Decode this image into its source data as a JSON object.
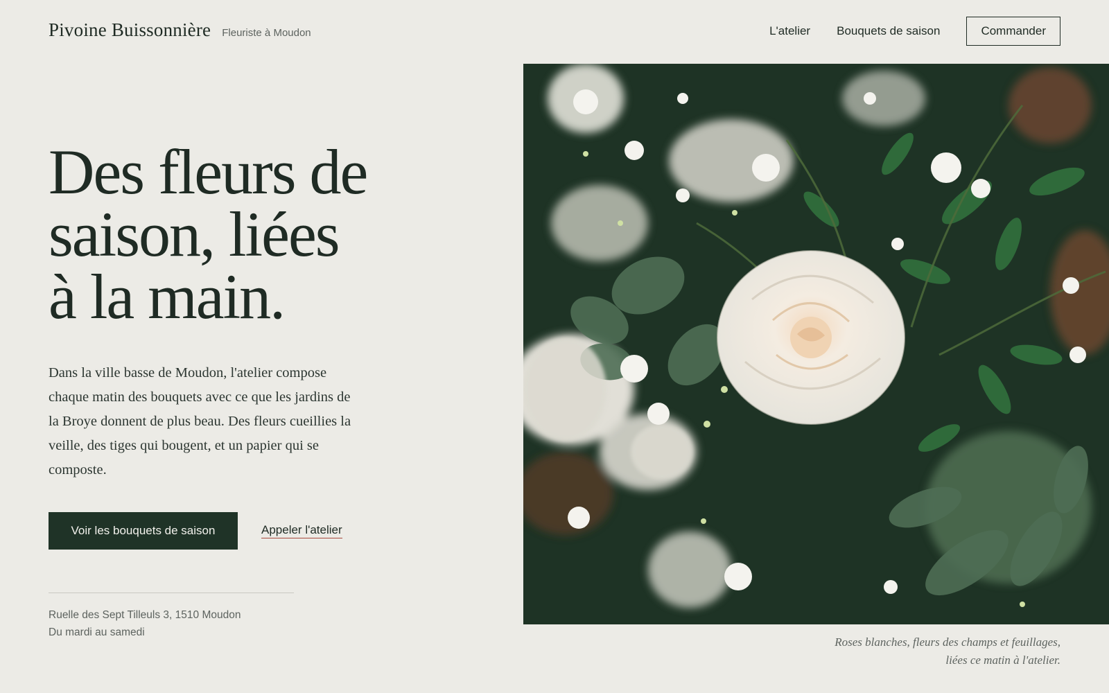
{
  "header": {
    "brand_name": "Pivoine Buissonnière",
    "brand_tagline": "Fleuriste à Moudon",
    "nav": [
      {
        "label": "L'atelier"
      },
      {
        "label": "Bouquets de saison"
      }
    ],
    "order_button": "Commander"
  },
  "hero": {
    "title_lines": [
      "Des fleurs de",
      "saison, liées",
      "à la main."
    ],
    "paragraph": "Dans la ville basse de Moudon, l'atelier compose chaque matin des bouquets avec ce que les jardins de la Broye donnent de plus beau. Des fleurs cueillies la veille, des tiges qui bougent, et un papier qui se composte.",
    "primary_cta": "Voir les bouquets de saison",
    "secondary_cta": "Appeler l'atelier"
  },
  "info": {
    "address": "Ruelle des Sept Tilleuls 3, 1510 Moudon",
    "hours": "Du mardi au samedi"
  },
  "photo": {
    "caption_line1": "Roses blanches, fleurs des champs et feuillages,",
    "caption_line2": "liées ce matin à l'atelier."
  },
  "colors": {
    "background": "#ecebe6",
    "ink": "#1f2b24",
    "primary_button": "#1f3327",
    "link_underline": "#a8483c",
    "muted_text": "#5d635f"
  }
}
